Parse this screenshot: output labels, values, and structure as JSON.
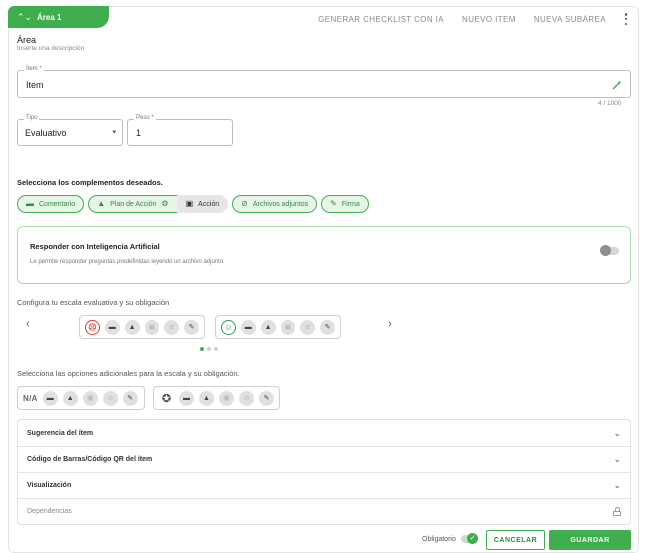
{
  "area_tab": {
    "title": "Área 1",
    "toggle_glyph": "⌃⌄"
  },
  "top_actions": {
    "generate_checklist": "GENERAR CHECKLIST CON IA",
    "new_item": "NUEVO ITEM",
    "new_subarea": "NUEVA SUBÁREA"
  },
  "area": {
    "title": "Área",
    "description": "Inserte una descripción"
  },
  "item_field": {
    "label": "Ítem *",
    "value": "Item",
    "counter": "4 / 1000",
    "icon": "magic-wand-icon"
  },
  "type_field": {
    "label": "Tipo",
    "value": "Evaluativo",
    "caret": "▾"
  },
  "weight_field": {
    "label": "Peso *",
    "value": "1"
  },
  "complements": {
    "title": "Selecciona los complementos deseados.",
    "chips": {
      "comment": {
        "label": "Comentario",
        "icon": "comment-icon",
        "glyph": "▬"
      },
      "action_plan": {
        "label": "Plan de Acción",
        "icon": "warning-icon",
        "glyph": "▲",
        "settings_glyph": "⚙"
      },
      "action": {
        "label": "Acción",
        "glyph": "▣"
      },
      "attachments": {
        "label": "Archivos adjuntos",
        "icon": "paperclip-icon",
        "glyph": "⊘"
      },
      "signature": {
        "label": "Firma",
        "icon": "signature-icon",
        "glyph": "✎"
      }
    }
  },
  "ai": {
    "title": "Responder con Inteligencia Artificial",
    "description": "Le permite responder preguntas predefinidas leyendo un archivo adjunto.",
    "enabled": false
  },
  "scale": {
    "title": "Configura tu escala evaluativa y su obligación",
    "prev": "‹",
    "next": "›",
    "faces": {
      "sad": "☹",
      "happy": "☺"
    },
    "icons": {
      "comment": "▬",
      "warning": "▲",
      "action": "▣",
      "attach": "⊘",
      "sign": "✎"
    },
    "pagination": {
      "active": 1,
      "total": 3
    }
  },
  "extra": {
    "title": "Selecciona las opciones adicionales para la escala y su obligación.",
    "na_label": "N/A",
    "badge_glyph": "✪"
  },
  "accordion": [
    {
      "label": "Sugerencia del ítem",
      "icon": "chevron-down-icon",
      "glyph": "⌄"
    },
    {
      "label": "Código de Barras/Código QR del ítem",
      "icon": "chevron-down-icon",
      "glyph": "⌄"
    },
    {
      "label": "Visualización",
      "icon": "chevron-down-icon",
      "glyph": "⌄"
    },
    {
      "label": "Dependencias",
      "icon": "lock-icon"
    }
  ],
  "footer": {
    "required_label": "Obligatorio",
    "required_on": true,
    "check_glyph": "✓",
    "cancel": "CANCELAR",
    "save": "GUARDAR"
  },
  "colors": {
    "accent": "#3fae4f",
    "accent_light": "#e6f5e8",
    "danger": "#e53935"
  }
}
